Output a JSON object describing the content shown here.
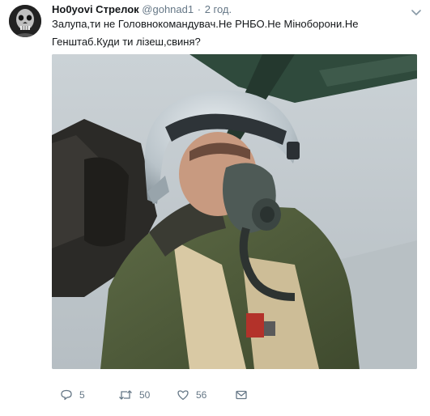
{
  "tweet": {
    "author_name": "Но0yovi Стрелок",
    "author_handle": "@gohnad1",
    "separator": "·",
    "timestamp": "2 год.",
    "text": "Залупа,ти не Головнокомандувач.Не РНБО.Не Міноборони.Не Генштаб.Куди ти лізеш,свиня?",
    "media": {
      "description": "pilot-in-cockpit-photo"
    },
    "actions": {
      "reply_count": "5",
      "retweet_count": "50",
      "like_count": "56"
    }
  },
  "colors": {
    "text_primary": "#14171a",
    "text_secondary": "#657786",
    "background": "#ffffff"
  }
}
